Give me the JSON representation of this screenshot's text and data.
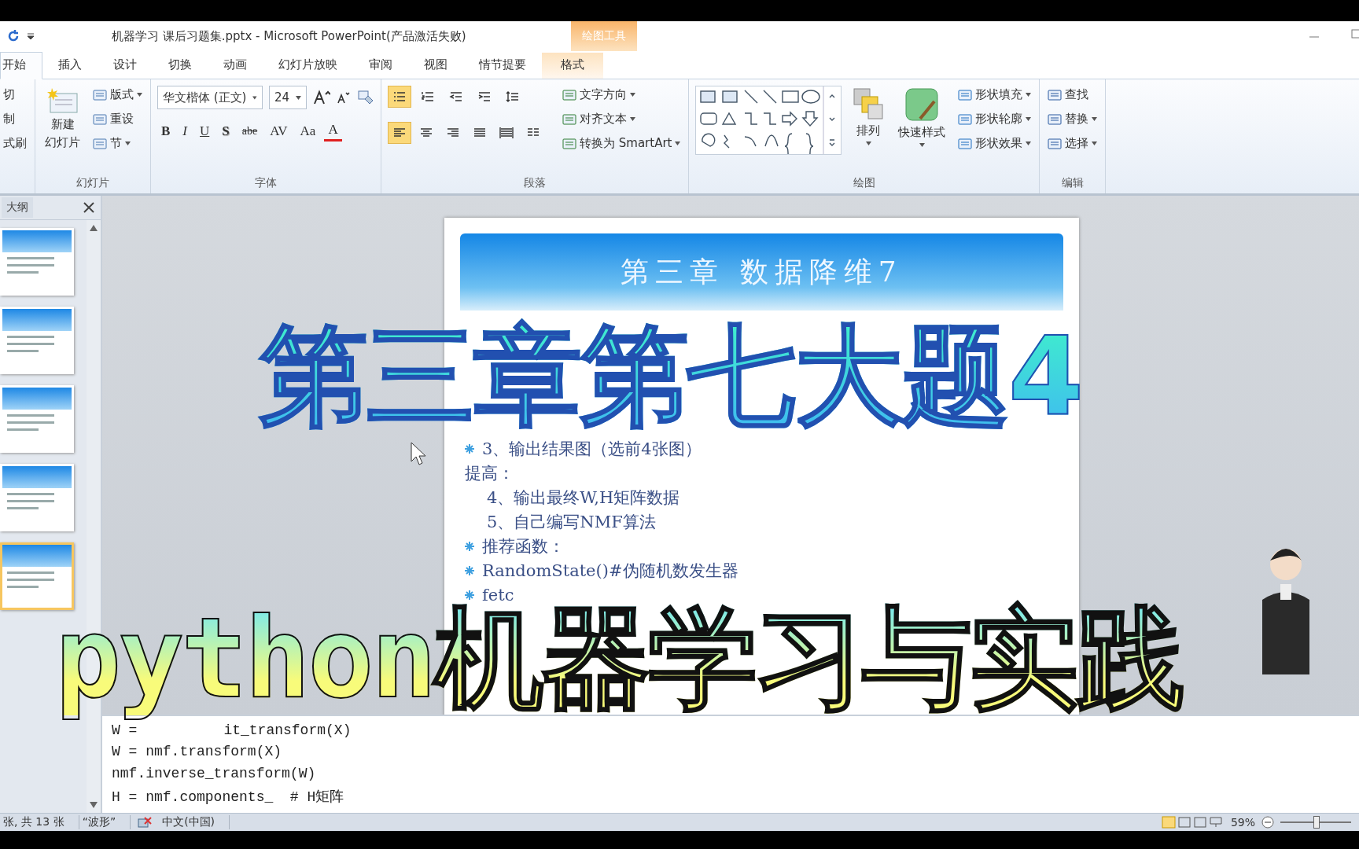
{
  "window": {
    "title": "机器学习 课后习题集.pptx - Microsoft PowerPoint(产品激活失败)",
    "context_group": "绘图工具"
  },
  "tabs": [
    {
      "label": "开始",
      "selected": true
    },
    {
      "label": "插入",
      "selected": false
    },
    {
      "label": "设计",
      "selected": false
    },
    {
      "label": "切换",
      "selected": false
    },
    {
      "label": "动画",
      "selected": false
    },
    {
      "label": "幻灯片放映",
      "selected": false
    },
    {
      "label": "审阅",
      "selected": false
    },
    {
      "label": "视图",
      "selected": false
    },
    {
      "label": "情节提要",
      "selected": false
    },
    {
      "label": "格式",
      "selected": false,
      "kind": "contextual"
    }
  ],
  "ribbon": [
    {
      "kind": "clipboard",
      "items": [
        "切",
        "制",
        "式刷"
      ]
    },
    {
      "kind": "slides",
      "name": "幻灯片",
      "new_slide": [
        "新建",
        "幻灯片"
      ],
      "items": [
        {
          "label": "版式",
          "dropdown": true
        },
        {
          "label": "重设",
          "dropdown": false
        },
        {
          "label": "节",
          "dropdown": true
        }
      ]
    },
    {
      "kind": "font",
      "name": "字体",
      "font": "华文楷体 (正文)",
      "size": "24",
      "buttons": [
        "B",
        "I",
        "U",
        "S",
        "abe",
        "AV",
        "Aa",
        "A"
      ]
    },
    {
      "kind": "paragraph",
      "name": "段落",
      "buttons": [
        {
          "kind": "bullets",
          "selected": true
        },
        {
          "kind": "numbering",
          "selected": false
        },
        {
          "kind": "outdent",
          "selected": false
        },
        {
          "kind": "indent",
          "selected": false
        },
        {
          "kind": "spacing",
          "selected": false
        },
        {
          "kind": "left",
          "selected": true
        },
        {
          "kind": "center",
          "selected": false
        },
        {
          "kind": "right",
          "selected": false
        },
        {
          "kind": "justify",
          "selected": false
        },
        {
          "kind": "distributed",
          "selected": false
        },
        {
          "kind": "columns",
          "selected": false
        }
      ],
      "commands": [
        {
          "label": "文字方向",
          "dropdown": true
        },
        {
          "label": "对齐文本",
          "dropdown": true
        },
        {
          "label": "转换为 SmartArt",
          "dropdown": true
        }
      ]
    },
    {
      "kind": "drawing",
      "name": "绘图",
      "big": [
        "排列",
        "快速样式"
      ],
      "commands": [
        {
          "label": "形状填充",
          "dropdown": true
        },
        {
          "label": "形状轮廓",
          "dropdown": true
        },
        {
          "label": "形状效果",
          "dropdown": true
        }
      ]
    },
    {
      "kind": "editing",
      "name": "编辑",
      "commands": [
        {
          "label": "查找",
          "dropdown": false
        },
        {
          "label": "替换",
          "dropdown": true
        },
        {
          "label": "选择",
          "dropdown": true
        }
      ]
    }
  ],
  "outline_pane": {
    "tab": "大纲",
    "thumbnails": [
      {
        "selected": false
      },
      {
        "selected": false
      },
      {
        "selected": false
      },
      {
        "selected": false
      },
      {
        "selected": true
      }
    ]
  },
  "slide": {
    "title": "第三章 数据降维7",
    "lines": [
      {
        "kind": "bullet",
        "text": "3、输出结果图（选前4张图）"
      },
      {
        "kind": "plain",
        "text": "提高："
      },
      {
        "kind": "indent",
        "text": "4、输出最终W,H矩阵数据"
      },
      {
        "kind": "indent",
        "text": "5、自己编写NMF算法"
      },
      {
        "kind": "bullet",
        "text": "推荐函数："
      },
      {
        "kind": "bullet",
        "text": "RandomState()#伪随机数发生器"
      },
      {
        "kind": "bullet",
        "text": "fetc"
      }
    ]
  },
  "notes": [
    [
      "W =",
      "it_transform(X)"
    ],
    [
      "W = nmf.transform(X)"
    ],
    [
      "nmf.inverse_transform(W)"
    ],
    [
      "H = nmf.components_  # H矩阵"
    ]
  ],
  "status_bar": {
    "slide_info": "张, 共 13 张",
    "theme": "“波形”",
    "language": "中文(中国)",
    "zoom": "59%",
    "level": 0.5
  },
  "overlay": {
    "headline": "第三章第七大题4",
    "subtitle": "python机器学习与实践"
  }
}
